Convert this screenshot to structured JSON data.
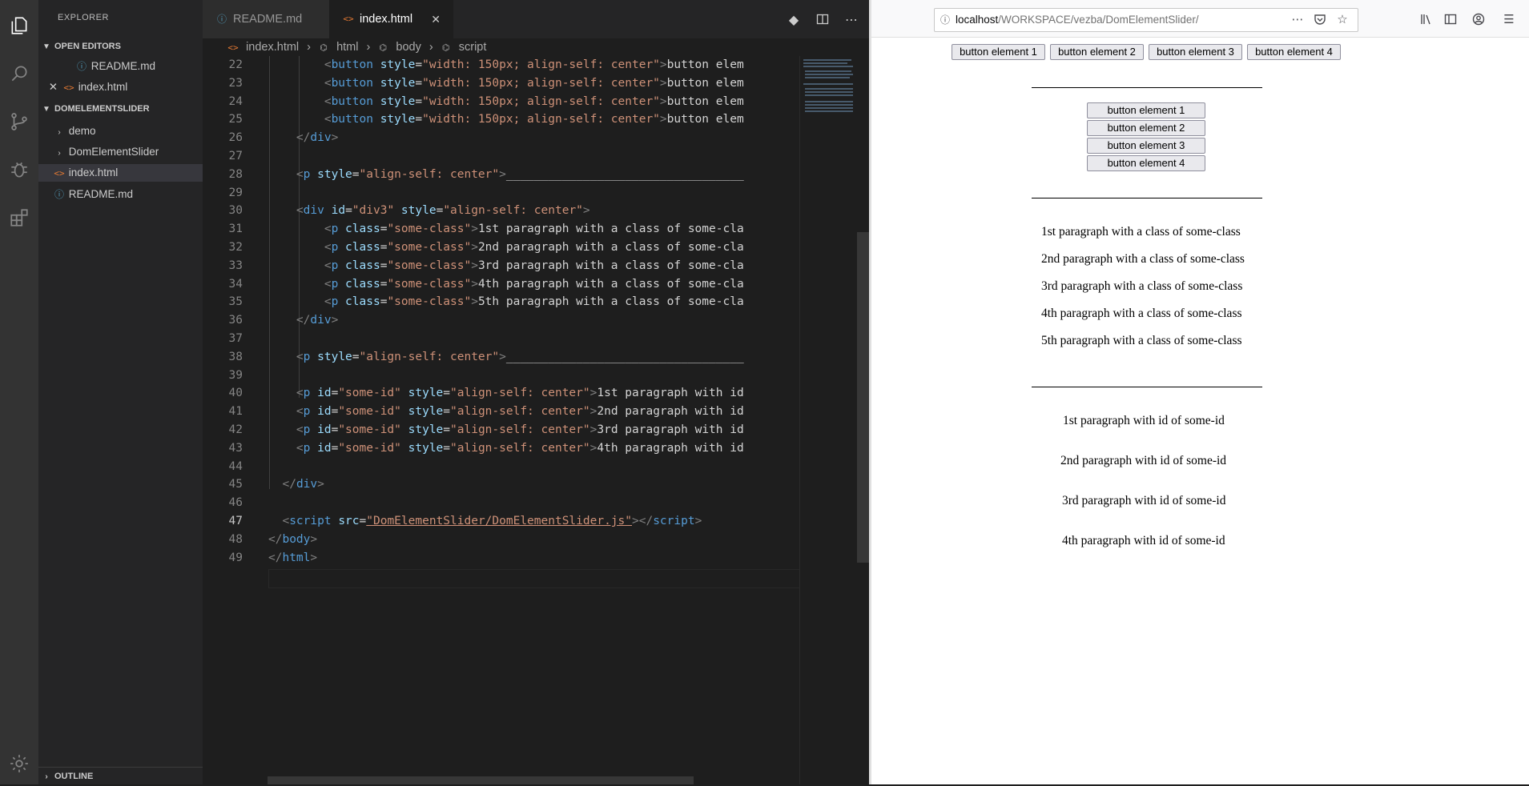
{
  "sidebar": {
    "title": "EXPLORER",
    "open_editors_label": "OPEN EDITORS",
    "open_editors": [
      "README.md",
      "index.html"
    ],
    "project_label": "DOMELEMENTSLIDER",
    "tree": [
      "demo",
      "DomElementSlider",
      "index.html",
      "README.md"
    ],
    "outline_label": "OUTLINE"
  },
  "tabs": [
    {
      "label": "README.md"
    },
    {
      "label": "index.html"
    }
  ],
  "breadcrumb": [
    "index.html",
    "html",
    "body",
    "script"
  ],
  "editor": {
    "line_numbers": [
      "22",
      "23",
      "24",
      "25",
      "26",
      "27",
      "28",
      "29",
      "30",
      "31",
      "32",
      "33",
      "34",
      "35",
      "36",
      "37",
      "38",
      "39",
      "40",
      "41",
      "42",
      "43",
      "44",
      "45",
      "46",
      "47",
      "48",
      "49"
    ],
    "current_line": "47"
  },
  "browser": {
    "url_host": "localhost",
    "url_path": "/WORKSPACE/vezba/DomElementSlider/",
    "row_buttons": [
      "button element 1",
      "button element 2",
      "button element 3",
      "button element 4"
    ],
    "col_buttons": [
      "button element 1",
      "button element 2",
      "button element 3",
      "button element 4"
    ],
    "class_paragraphs": [
      "1st paragraph with a class of some-class",
      "2nd paragraph with a class of some-class",
      "3rd paragraph with a class of some-class",
      "4th paragraph with a class of some-class",
      "5th paragraph with a class of some-class"
    ],
    "id_paragraphs": [
      "1st paragraph with id of some-id",
      "2nd paragraph with id of some-id",
      "3rd paragraph with id of some-id",
      "4th paragraph with id of some-id"
    ]
  }
}
